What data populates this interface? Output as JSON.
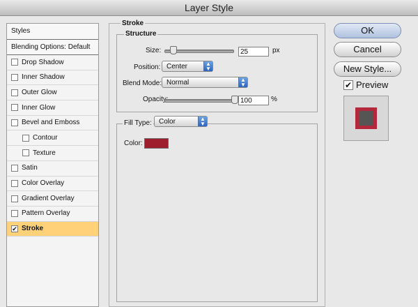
{
  "window": {
    "title": "Layer Style"
  },
  "styles_list": {
    "header": "Styles",
    "blending_options": "Blending Options: Default",
    "items": [
      {
        "label": "Drop Shadow",
        "checked": false,
        "indent": false,
        "selected": false
      },
      {
        "label": "Inner Shadow",
        "checked": false,
        "indent": false,
        "selected": false
      },
      {
        "label": "Outer Glow",
        "checked": false,
        "indent": false,
        "selected": false
      },
      {
        "label": "Inner Glow",
        "checked": false,
        "indent": false,
        "selected": false
      },
      {
        "label": "Bevel and Emboss",
        "checked": false,
        "indent": false,
        "selected": false
      },
      {
        "label": "Contour",
        "checked": false,
        "indent": true,
        "selected": false
      },
      {
        "label": "Texture",
        "checked": false,
        "indent": true,
        "selected": false
      },
      {
        "label": "Satin",
        "checked": false,
        "indent": false,
        "selected": false
      },
      {
        "label": "Color Overlay",
        "checked": false,
        "indent": false,
        "selected": false
      },
      {
        "label": "Gradient Overlay",
        "checked": false,
        "indent": false,
        "selected": false
      },
      {
        "label": "Pattern Overlay",
        "checked": false,
        "indent": false,
        "selected": false
      },
      {
        "label": "Stroke",
        "checked": true,
        "indent": false,
        "selected": true
      }
    ]
  },
  "stroke": {
    "group_title": "Stroke",
    "structure_title": "Structure",
    "size": {
      "label": "Size:",
      "value": "25",
      "unit": "px",
      "slider_fraction": 0.12
    },
    "position": {
      "label": "Position:",
      "value": "Center"
    },
    "blend_mode": {
      "label": "Blend Mode:",
      "value": "Normal"
    },
    "opacity": {
      "label": "Opacity:",
      "value": "100",
      "unit": "%",
      "slider_fraction": 1.0
    },
    "fill_type": {
      "label": "Fill Type:",
      "value": "Color"
    },
    "color": {
      "label": "Color:",
      "hex": "#9e1e2d"
    }
  },
  "buttons": {
    "ok": "OK",
    "cancel": "Cancel",
    "new_style": "New Style..."
  },
  "preview": {
    "label": "Preview",
    "checked": true,
    "stroke_color": "#b3283a",
    "fill_color": "#555555"
  }
}
